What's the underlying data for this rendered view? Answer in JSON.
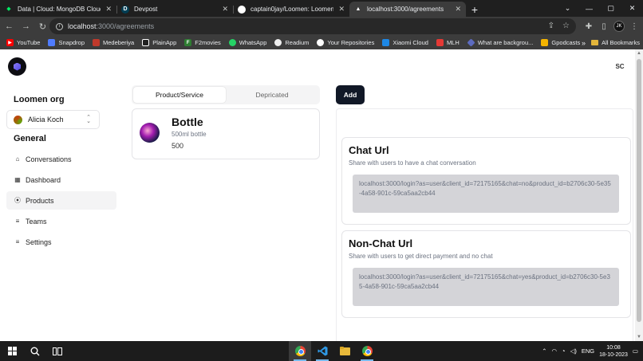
{
  "browser": {
    "tabs": [
      {
        "title": "Data | Cloud: MongoDB Cloud",
        "icon": "mongodb-leaf-icon",
        "active": false
      },
      {
        "title": "Devpost",
        "icon": "devpost-icon",
        "active": false
      },
      {
        "title": "captain0jay/Loomen: Loomen is",
        "icon": "github-icon",
        "active": false
      },
      {
        "title": "localhost:3000/agreements",
        "icon": "triangle-icon",
        "active": true
      }
    ],
    "new_tab_label": "+",
    "address": {
      "host": "localhost",
      "path": ":3000/agreements"
    },
    "profile_initials": "JK",
    "bookmarks": [
      {
        "label": "YouTube",
        "color": "#ff0000"
      },
      {
        "label": "Snapdrop",
        "color": "#4f7cff"
      },
      {
        "label": "Medeberiya",
        "color": "#c0392b"
      },
      {
        "label": "PlainApp",
        "color": "#222222"
      },
      {
        "label": "F2movies",
        "color": "#2e7d32"
      },
      {
        "label": "WhatsApp",
        "color": "#25d366"
      },
      {
        "label": "Readium",
        "color": "#555555"
      },
      {
        "label": "Your Repositories",
        "color": "#333333"
      },
      {
        "label": "Xiaomi Cloud",
        "color": "#1e88e5"
      },
      {
        "label": "MLH",
        "color": "#e53935"
      },
      {
        "label": "What are backgrou...",
        "color": "#5c6bc0"
      },
      {
        "label": "Gpodcasts",
        "color": "#f4b400"
      }
    ],
    "bookmarks_more": "»",
    "all_bookmarks": "All Bookmarks"
  },
  "app": {
    "user_initials": "SC",
    "sidebar": {
      "org_name": "Loomen org",
      "selected_user": "Alicia Koch",
      "section_title": "General",
      "items": [
        {
          "label": "Conversations",
          "icon": "home-icon",
          "active": false
        },
        {
          "label": "Dashboard",
          "icon": "grid-icon",
          "active": false
        },
        {
          "label": "Products",
          "icon": "broadcast-icon",
          "active": true
        },
        {
          "label": "Teams",
          "icon": "list-icon",
          "active": false
        },
        {
          "label": "Settings",
          "icon": "list-icon",
          "active": false
        }
      ]
    },
    "tabs": {
      "product_service": "Product/Service",
      "depricated": "Depricated"
    },
    "product": {
      "name": "Bottle",
      "description": "500ml bottle",
      "price": "500"
    },
    "add_button": "Add",
    "chat_url": {
      "title": "Chat Url",
      "subtitle": "Share with users to have a chat conversation",
      "url": "localhost:3000/login?as=user&client_id=72175165&chat=no&product_id=b2706c30-5e35-4a58-901c-59ca5aa2cb44"
    },
    "non_chat_url": {
      "title": "Non-Chat Url",
      "subtitle": "Share with users to get direct payment and no chat",
      "url": "localhost:3000/login?as=user&client_id=72175165&chat=yes&product_id=b2706c30-5e35-4a58-901c-59ca5aa2cb44"
    }
  },
  "taskbar": {
    "tray_lang": "ENG",
    "time": "10:08",
    "date": "18-10-2023"
  }
}
